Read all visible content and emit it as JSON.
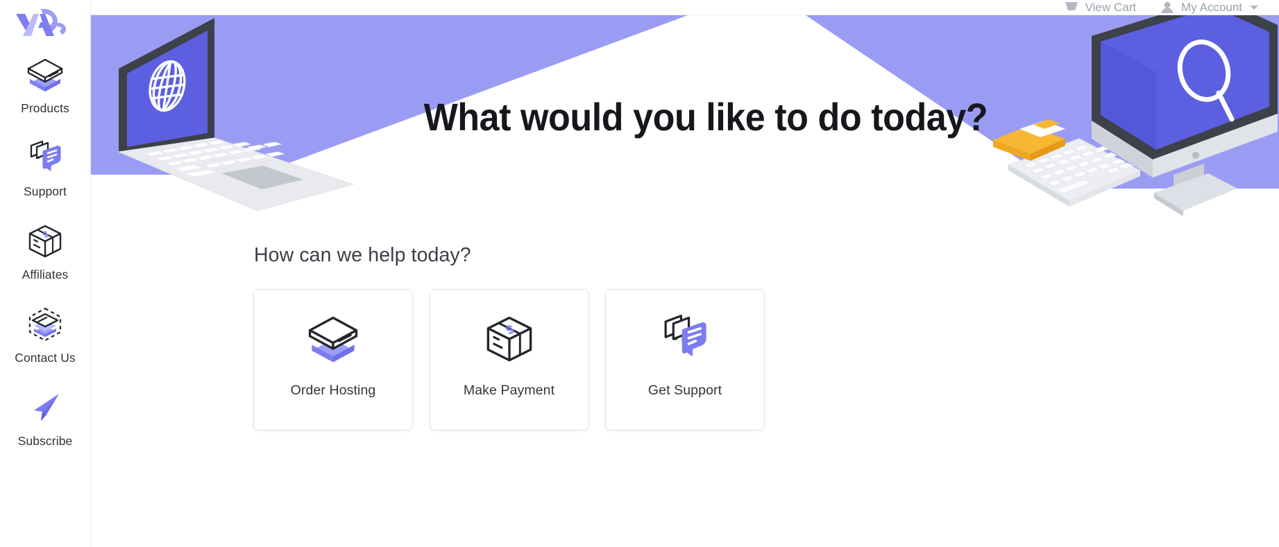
{
  "brand": {
    "logo_name": "va-logo",
    "accent": "#7b7df0",
    "accent_light": "#9b9df6",
    "screen_blue": "#5b5fe0",
    "band_purple": "#9a9cf4",
    "folder_orange": "#f5a623",
    "text_dark": "#15171c",
    "text_body": "#31343b",
    "text_muted": "#9aa0ad",
    "border": "#eceef2"
  },
  "sidebar": {
    "items": [
      {
        "label": "Products",
        "icon": "stacked-box-icon"
      },
      {
        "label": "Support",
        "icon": "chat-bubbles-icon"
      },
      {
        "label": "Affiliates",
        "icon": "dollar-cube-icon"
      },
      {
        "label": "Contact Us",
        "icon": "dashed-layers-icon"
      },
      {
        "label": "Subscribe",
        "icon": "paper-plane-icon"
      }
    ]
  },
  "topbar": {
    "cart_label": "View Cart",
    "cart_icon": "shopping-cart-icon",
    "account_label": "My Account",
    "account_icon": "user-avatar-icon",
    "account_caret": "chevron-down-icon"
  },
  "hero": {
    "title": "What would you like to do today?",
    "illustration_left": "isometric-laptop-globe-illustration",
    "illustration_right": "isometric-imac-search-illustration"
  },
  "help": {
    "heading": "How can we help today?",
    "cards": [
      {
        "label": "Order Hosting",
        "icon": "stacked-box-icon"
      },
      {
        "label": "Make Payment",
        "icon": "dollar-cube-icon"
      },
      {
        "label": "Get Support",
        "icon": "chat-bubbles-icon"
      }
    ]
  }
}
